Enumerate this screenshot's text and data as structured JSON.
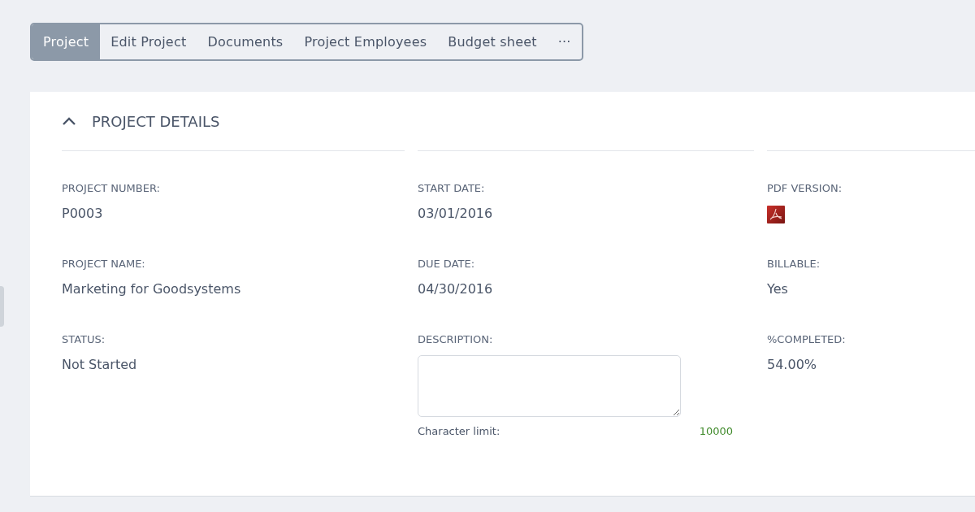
{
  "tabs": [
    {
      "label": "Project",
      "selected": true
    },
    {
      "label": "Edit Project",
      "selected": false
    },
    {
      "label": "Documents",
      "selected": false
    },
    {
      "label": "Project Employees",
      "selected": false
    },
    {
      "label": "Budget sheet",
      "selected": false
    },
    {
      "label": "···",
      "selected": false
    }
  ],
  "section": {
    "title": "PROJECT DETAILS",
    "expanded": true,
    "columns": [
      {
        "fields": [
          {
            "kind": "text",
            "label": "PROJECT NUMBER:",
            "value": "P0003"
          },
          {
            "kind": "text",
            "label": "PROJECT NAME:",
            "value": "Marketing for Goodsystems"
          },
          {
            "kind": "text",
            "label": "STATUS:",
            "value": "Not Started"
          }
        ]
      },
      {
        "fields": [
          {
            "kind": "text",
            "label": "START DATE:",
            "value": "03/01/2016"
          },
          {
            "kind": "text",
            "label": "DUE DATE:",
            "value": "04/30/2016"
          },
          {
            "kind": "textarea",
            "label": "DESCRIPTION:",
            "limit_label": "Character limit:",
            "limit_value": "10000"
          }
        ]
      },
      {
        "fields": [
          {
            "kind": "pdf",
            "label": "PDF VERSION:"
          },
          {
            "kind": "text",
            "label": "BILLABLE:",
            "value": "Yes"
          },
          {
            "kind": "text",
            "label": "%COMPLETED:",
            "value": "54.00%"
          }
        ]
      }
    ]
  }
}
